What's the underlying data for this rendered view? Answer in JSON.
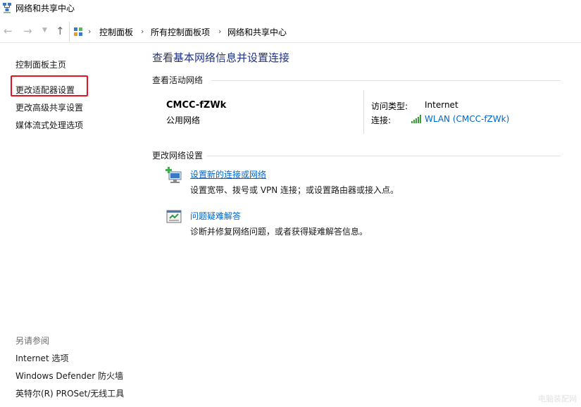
{
  "window": {
    "title": "网络和共享中心"
  },
  "nav": {
    "back_icon": "arrow-left-icon",
    "forward_icon": "arrow-right-icon",
    "recent_icon": "chevron-down-icon",
    "up_icon": "arrow-up-icon",
    "breadcrumb": [
      "控制面板",
      "所有控制面板项",
      "网络和共享中心"
    ]
  },
  "sidebar": {
    "links": [
      "控制面板主页",
      "更改适配器设置",
      "更改高级共享设置",
      "媒体流式处理选项"
    ],
    "highlighted_link": "更改适配器设置",
    "highlight_color": "#e81123",
    "see_also": {
      "title": "另请参阅",
      "links": [
        "Internet 选项",
        "Windows Defender 防火墙",
        "英特尔(R) PROSet/无线工具"
      ]
    }
  },
  "main": {
    "title": "查看基本网络信息并设置连接",
    "active_section": "查看活动网络",
    "network": {
      "name": "CMCC-fZWk",
      "category": "公用网络",
      "access_label": "访问类型:",
      "access_value": "Internet",
      "connection_label": "连接:",
      "connection_value": "WLAN (CMCC-fZWk)",
      "connection_icon": "wifi-signal-icon"
    },
    "change_section": "更改网络设置",
    "tasks": [
      {
        "title": "设置新的连接或网络",
        "desc": "设置宽带、拨号或 VPN 连接；或设置路由器或接入点。",
        "icon": "new-connection-icon"
      },
      {
        "title": "问题疑难解答",
        "desc": "诊断并修复网络问题，或者获得疑难解答信息。",
        "icon": "troubleshoot-icon"
      }
    ]
  },
  "watermark": "电脑装配网",
  "colors": {
    "title_blue": "#1e3287",
    "link_blue": "#0066cc",
    "signal_green": "#3b9a3b"
  }
}
